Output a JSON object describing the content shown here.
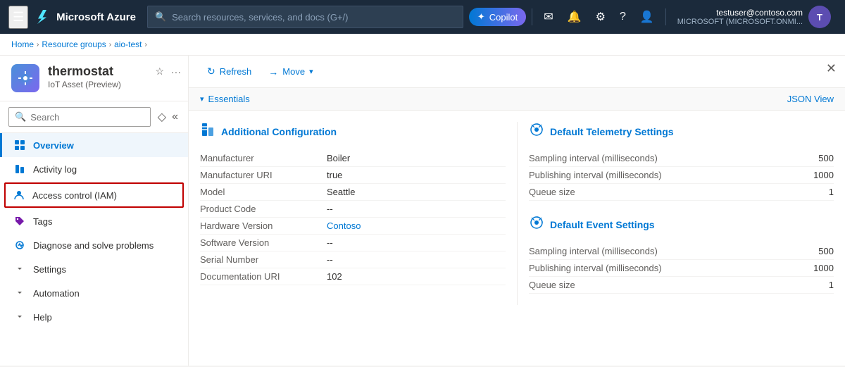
{
  "topbar": {
    "logo": "Microsoft Azure",
    "search_placeholder": "Search resources, services, and docs (G+/)",
    "copilot_label": "Copilot",
    "user_name": "testuser@contoso.com",
    "user_tenant": "MICROSOFT (MICROSOFT.ONMI...",
    "user_initials": "T"
  },
  "breadcrumb": {
    "items": [
      "Home",
      "Resource groups",
      "aio-test"
    ],
    "separators": [
      ">",
      ">",
      ">"
    ]
  },
  "resource": {
    "name": "thermostat",
    "type": "IoT Asset (Preview)"
  },
  "sidebar": {
    "search_placeholder": "Search",
    "nav_items": [
      {
        "id": "overview",
        "label": "Overview",
        "active": true,
        "icon": "⊞"
      },
      {
        "id": "activity-log",
        "label": "Activity log",
        "active": false,
        "icon": "📋"
      },
      {
        "id": "access-control",
        "label": "Access control (IAM)",
        "active": false,
        "highlighted": true,
        "icon": "👤"
      },
      {
        "id": "tags",
        "label": "Tags",
        "active": false,
        "icon": "🏷"
      },
      {
        "id": "diagnose",
        "label": "Diagnose and solve problems",
        "active": false,
        "icon": "🔧"
      },
      {
        "id": "settings",
        "label": "Settings",
        "active": false,
        "expandable": true,
        "icon": ""
      },
      {
        "id": "automation",
        "label": "Automation",
        "active": false,
        "expandable": true,
        "icon": ""
      },
      {
        "id": "help",
        "label": "Help",
        "active": false,
        "expandable": true,
        "icon": ""
      }
    ]
  },
  "toolbar": {
    "refresh_label": "Refresh",
    "move_label": "Move"
  },
  "essentials": {
    "label": "Essentials",
    "json_view": "JSON View"
  },
  "additional_config": {
    "title": "Additional Configuration",
    "rows": [
      {
        "label": "Manufacturer",
        "value": "Boiler",
        "is_link": false
      },
      {
        "label": "Manufacturer URI",
        "value": "true",
        "is_link": false
      },
      {
        "label": "Model",
        "value": "Seattle",
        "is_link": false
      },
      {
        "label": "Product Code",
        "value": "--",
        "is_link": false
      },
      {
        "label": "Hardware Version",
        "value": "Contoso",
        "is_link": true
      },
      {
        "label": "Software Version",
        "value": "--",
        "is_link": false
      },
      {
        "label": "Serial Number",
        "value": "--",
        "is_link": false
      },
      {
        "label": "Documentation URI",
        "value": "102",
        "is_link": false
      }
    ]
  },
  "default_telemetry": {
    "title": "Default Telemetry Settings",
    "rows": [
      {
        "label": "Sampling interval (milliseconds)",
        "value": "500"
      },
      {
        "label": "Publishing interval (milliseconds)",
        "value": "1000"
      },
      {
        "label": "Queue size",
        "value": "1"
      }
    ]
  },
  "default_event": {
    "title": "Default Event Settings",
    "rows": [
      {
        "label": "Sampling interval (milliseconds)",
        "value": "500"
      },
      {
        "label": "Publishing interval (milliseconds)",
        "value": "1000"
      },
      {
        "label": "Queue size",
        "value": "1"
      }
    ]
  }
}
